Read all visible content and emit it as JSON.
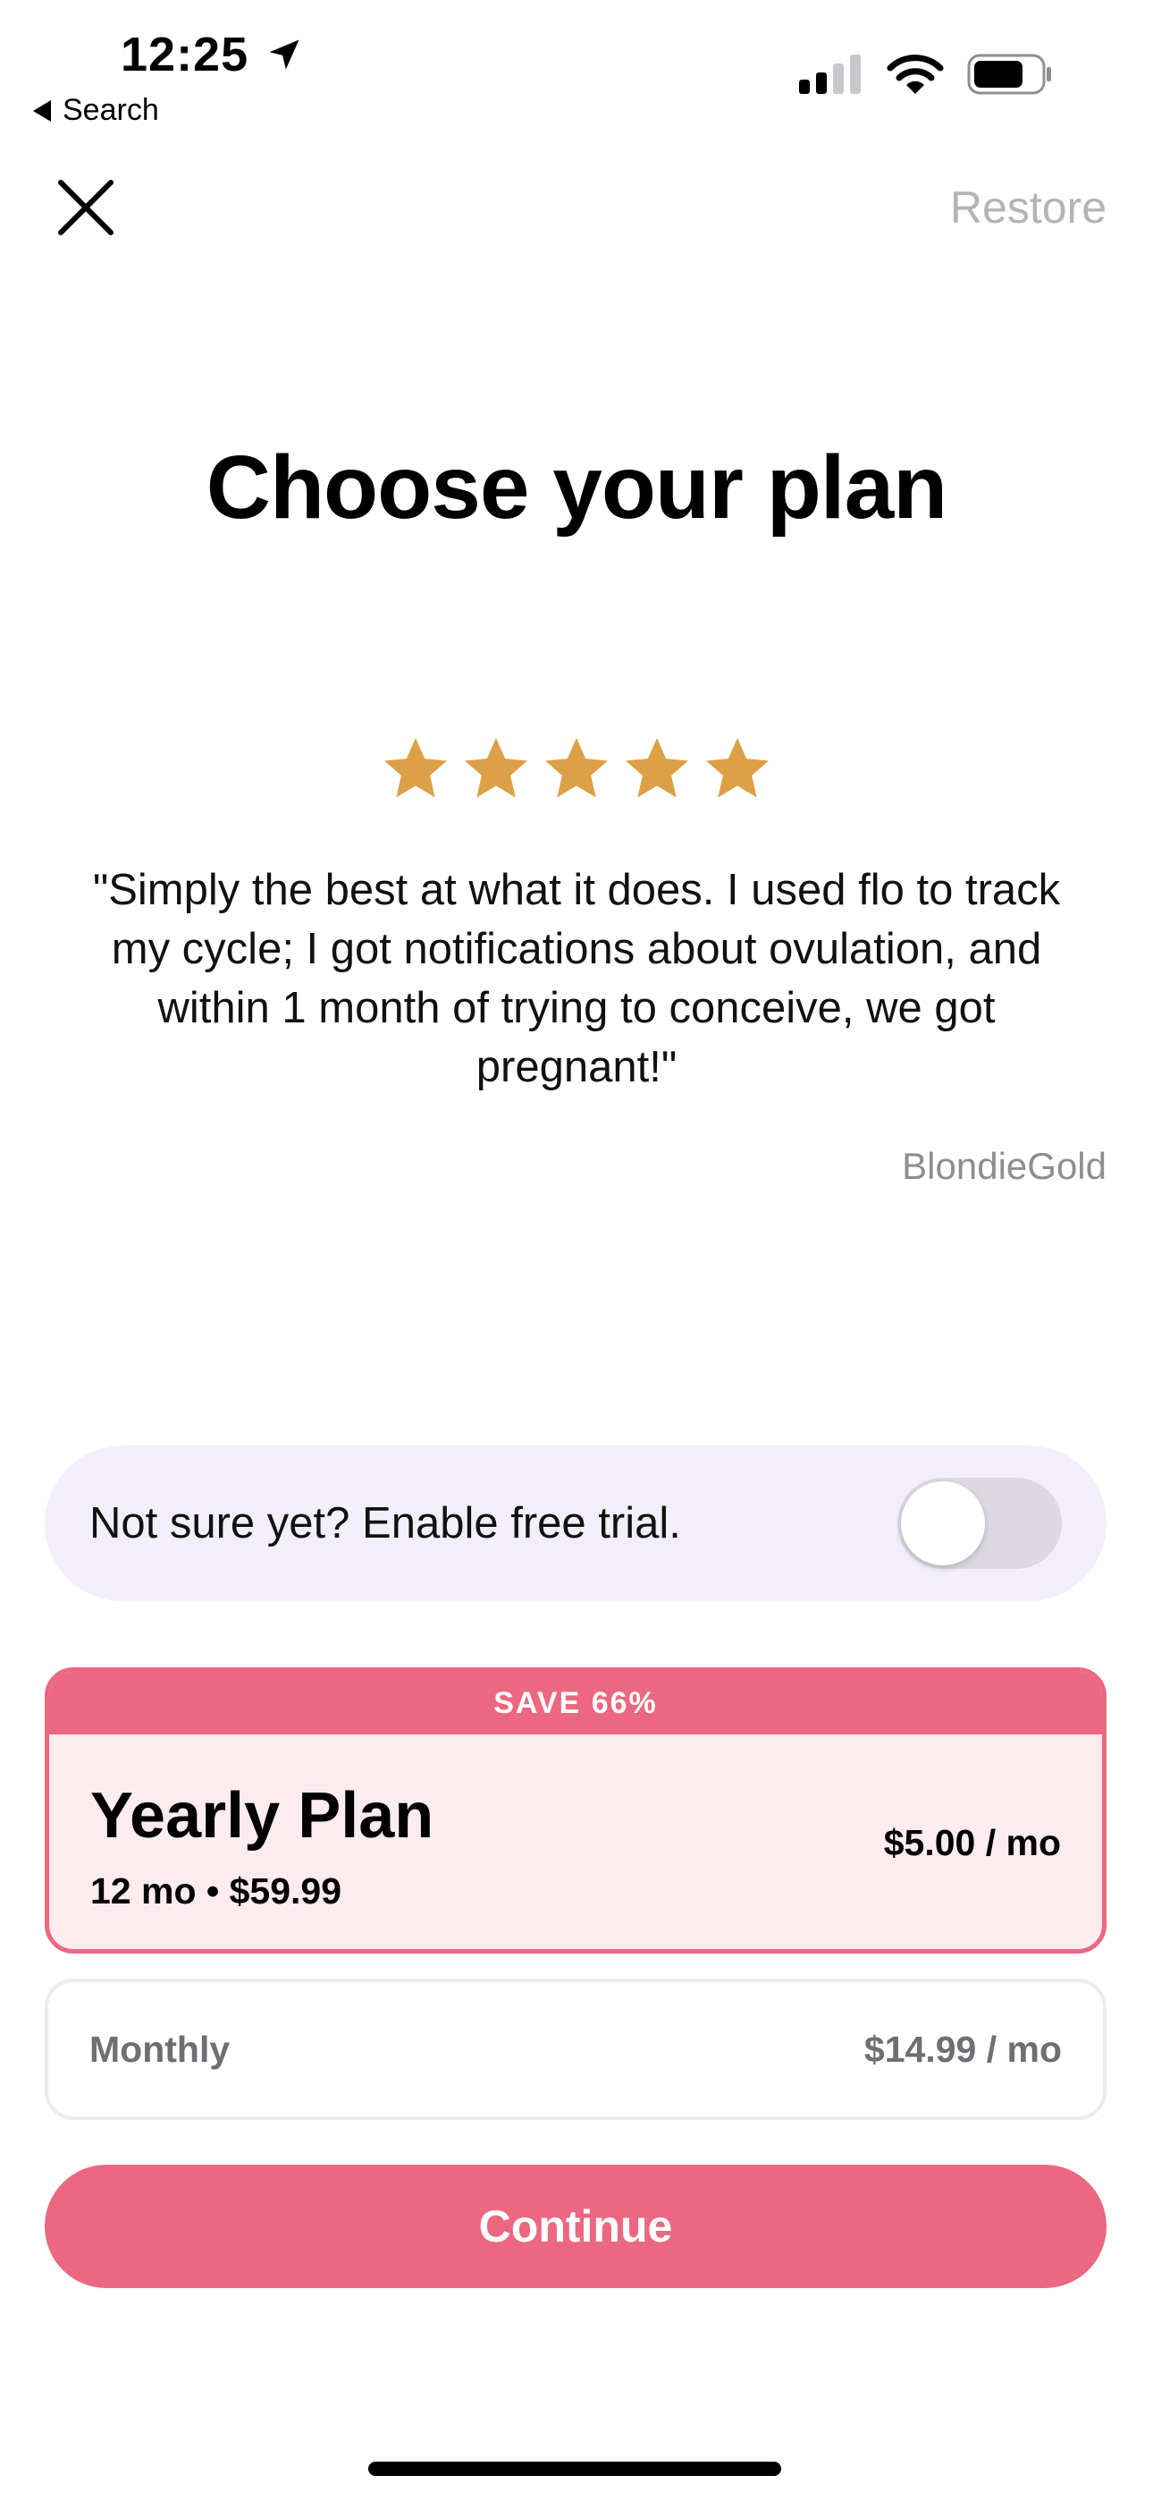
{
  "status_bar": {
    "time": "12:25",
    "back_label": "Search",
    "icons": [
      "location-arrow-icon",
      "cellular-signal-icon",
      "wifi-icon",
      "battery-icon"
    ]
  },
  "header": {
    "close_icon": "close-icon",
    "restore_label": "Restore"
  },
  "title": "Choose your plan",
  "review": {
    "rating": 5,
    "star_color": "#dca047",
    "quote": "\"Simply the best at what it does. I used flo to track my cycle; I got notifications about ovulation, and within 1 month of trying to conceive, we got pregnant!\"",
    "author": "BlondieGold"
  },
  "trial": {
    "label": "Not sure yet? Enable free trial.",
    "enabled": false
  },
  "plans": {
    "yearly": {
      "badge": "SAVE 66%",
      "name": "Yearly Plan",
      "sub": "12 mo • $59.99",
      "price": "$5.00 / mo",
      "selected": true
    },
    "monthly": {
      "name": "Monthly",
      "price": "$14.99 / mo",
      "selected": false
    }
  },
  "cta": {
    "label": "Continue"
  },
  "colors": {
    "accent": "#ec6780",
    "accent_light": "#fcecf0",
    "trial_bg": "#f2effb",
    "muted_text": "#b3b3b8"
  }
}
